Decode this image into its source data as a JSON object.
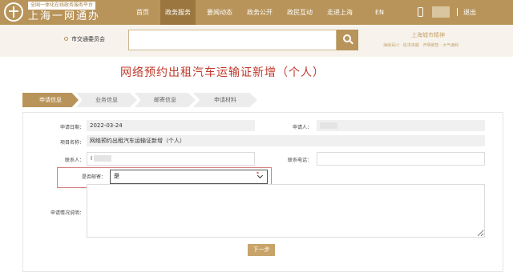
{
  "header": {
    "logo_tag": "全国一体化在线政务服务平台",
    "logo_name": "上海一网通办",
    "nav": [
      "首页",
      "政务服务",
      "要闻动态",
      "政务公开",
      "政民互动",
      "走进上海",
      "EN"
    ],
    "active_nav": "政务服务",
    "logout": "退出"
  },
  "search": {
    "location": "市交通委员会",
    "placeholder": ""
  },
  "brand": {
    "title": "上海城市精神",
    "links": "海纳百川 · 追求卓越 · 开明睿智 · 大气谦和"
  },
  "page_title": "网络预约出租汽车运输证新增（个人）",
  "steps": [
    "申请信息",
    "业务信息",
    "邮寄信息",
    "申请材料"
  ],
  "form": {
    "apply_date_label": "申请日期：",
    "apply_date": "2022-03-24",
    "applicant_label": "申请人：",
    "item_name_label": "项目名称：",
    "item_name": "网络预约出租汽车运输证新增（个人）",
    "contact_label": "联系人：",
    "contact_value": "I",
    "phone_label": "联系电话：",
    "mail_label": "是否邮寄：",
    "mail_value": "是",
    "required_mark": "*",
    "desc_label": "申请情况说明："
  },
  "buttons": {
    "next": "下一步"
  },
  "colors": {
    "brand": "#b8945a",
    "title_red": "#c0392b",
    "highlight": "#d77f85"
  }
}
